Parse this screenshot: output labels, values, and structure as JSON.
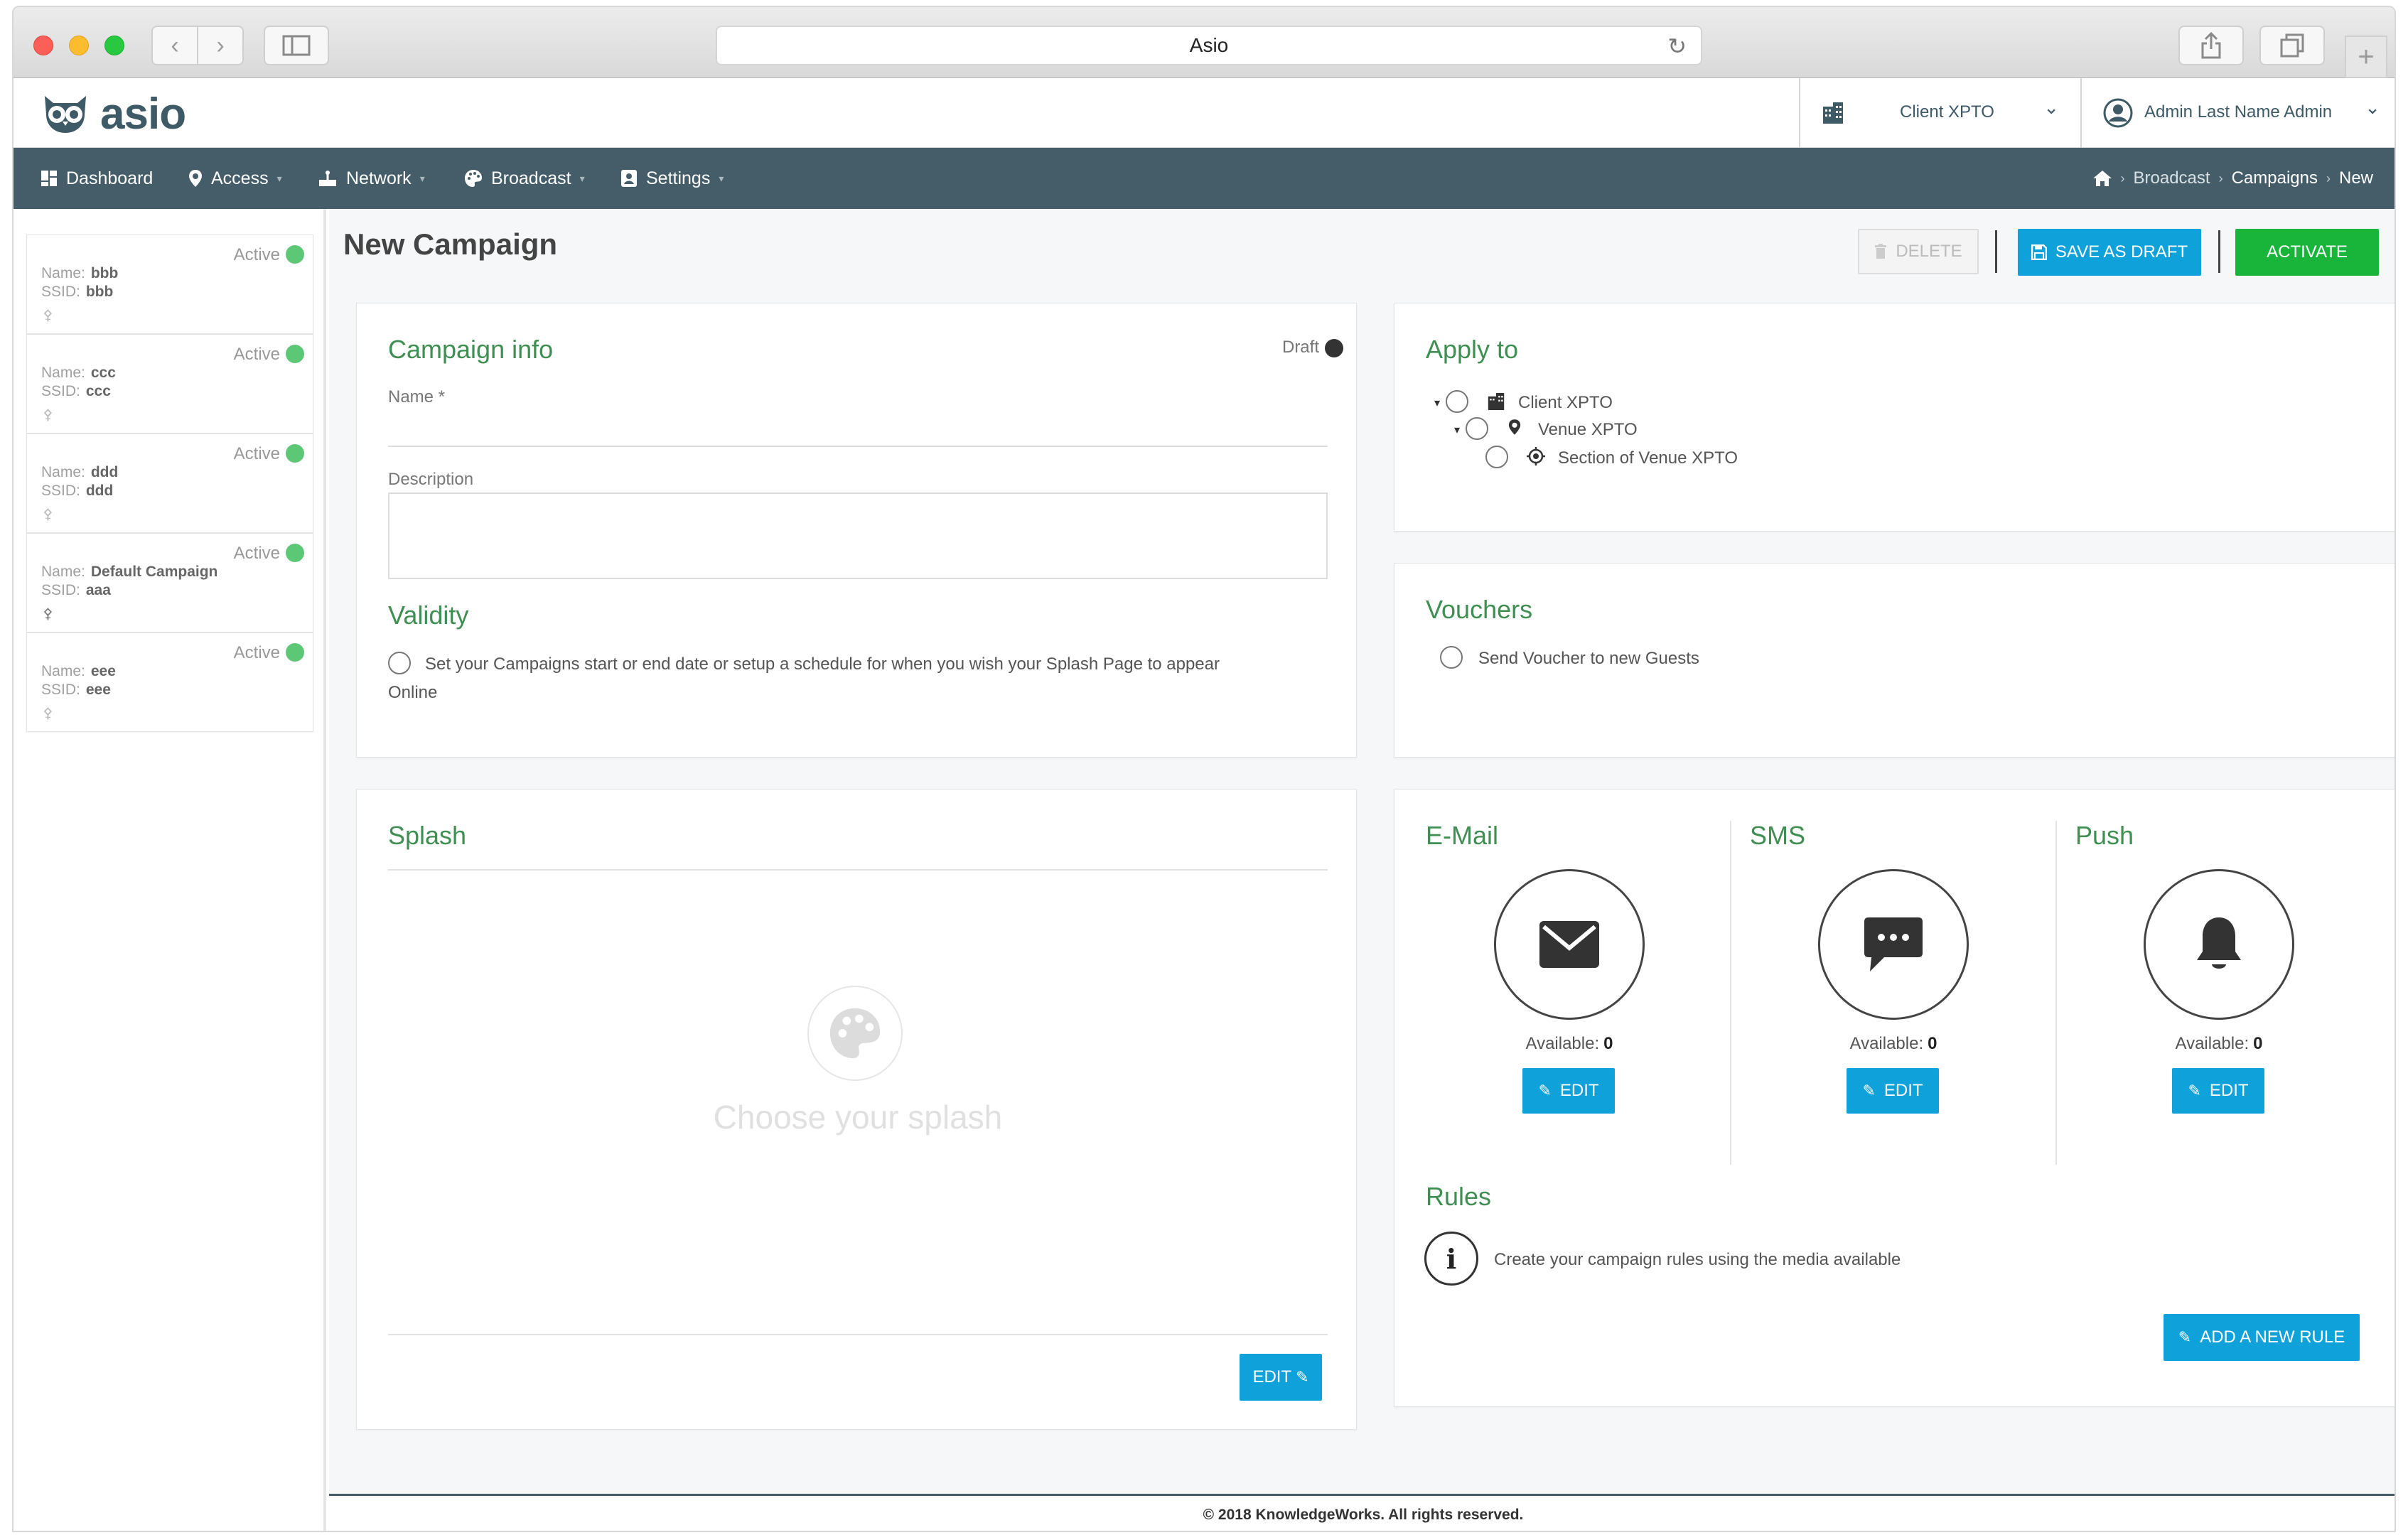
{
  "browser": {
    "title": "Asio"
  },
  "header": {
    "logo_text": "asio",
    "client_select": "Client XPTO",
    "user_select": "Admin Last Name Admin"
  },
  "nav": {
    "items": [
      {
        "label": "Dashboard"
      },
      {
        "label": "Access"
      },
      {
        "label": "Network"
      },
      {
        "label": "Broadcast"
      },
      {
        "label": "Settings"
      }
    ],
    "breadcrumb": [
      "Broadcast",
      "Campaigns",
      "New"
    ]
  },
  "sidebar": {
    "name_label": "Name:",
    "ssid_label": "SSID:",
    "campaigns": [
      {
        "status": "Active",
        "name": "bbb",
        "ssid": "bbb"
      },
      {
        "status": "Active",
        "name": "ccc",
        "ssid": "ccc"
      },
      {
        "status": "Active",
        "name": "ddd",
        "ssid": "ddd"
      },
      {
        "status": "Active",
        "name": "Default Campaign",
        "ssid": "aaa"
      },
      {
        "status": "Active",
        "name": "eee",
        "ssid": "eee"
      }
    ]
  },
  "page": {
    "title": "New Campaign",
    "delete_label": "DELETE",
    "save_draft_label": "SAVE AS DRAFT",
    "activate_label": "ACTIVATE"
  },
  "campaign_info": {
    "title": "Campaign info",
    "status": "Draft",
    "name_label": "Name *",
    "name_value": "",
    "description_label": "Description",
    "description_value": "",
    "validity_title": "Validity",
    "validity_option": "Set your Campaigns start or end date or setup a schedule for when you wish your Splash Page to appear",
    "validity_state": "Online"
  },
  "apply_to": {
    "title": "Apply to",
    "tree": [
      {
        "label": "Client XPTO"
      },
      {
        "label": "Venue XPTO"
      },
      {
        "label": "Section of Venue XPTO"
      }
    ]
  },
  "vouchers": {
    "title": "Vouchers",
    "option": "Send Voucher to new Guests"
  },
  "splash": {
    "title": "Splash",
    "placeholder": "Choose your splash",
    "edit_label": "EDIT"
  },
  "media": {
    "available_label": "Available:",
    "edit_label": "EDIT",
    "channels": [
      {
        "title": "E-Mail",
        "available": "0"
      },
      {
        "title": "SMS",
        "available": "0"
      },
      {
        "title": "Push",
        "available": "0"
      }
    ]
  },
  "rules": {
    "title": "Rules",
    "text": "Create your campaign rules using the media available",
    "add_label": "ADD A NEW RULE"
  },
  "footer": {
    "text": "© 2018 KnowledgeWorks. All rights reserved."
  },
  "colors": {
    "nav_bg": "#445d68",
    "accent_green": "#3f8f52",
    "button_blue": "#0fa1d9",
    "activate_green": "#18b53a",
    "status_active": "#5cc774"
  }
}
